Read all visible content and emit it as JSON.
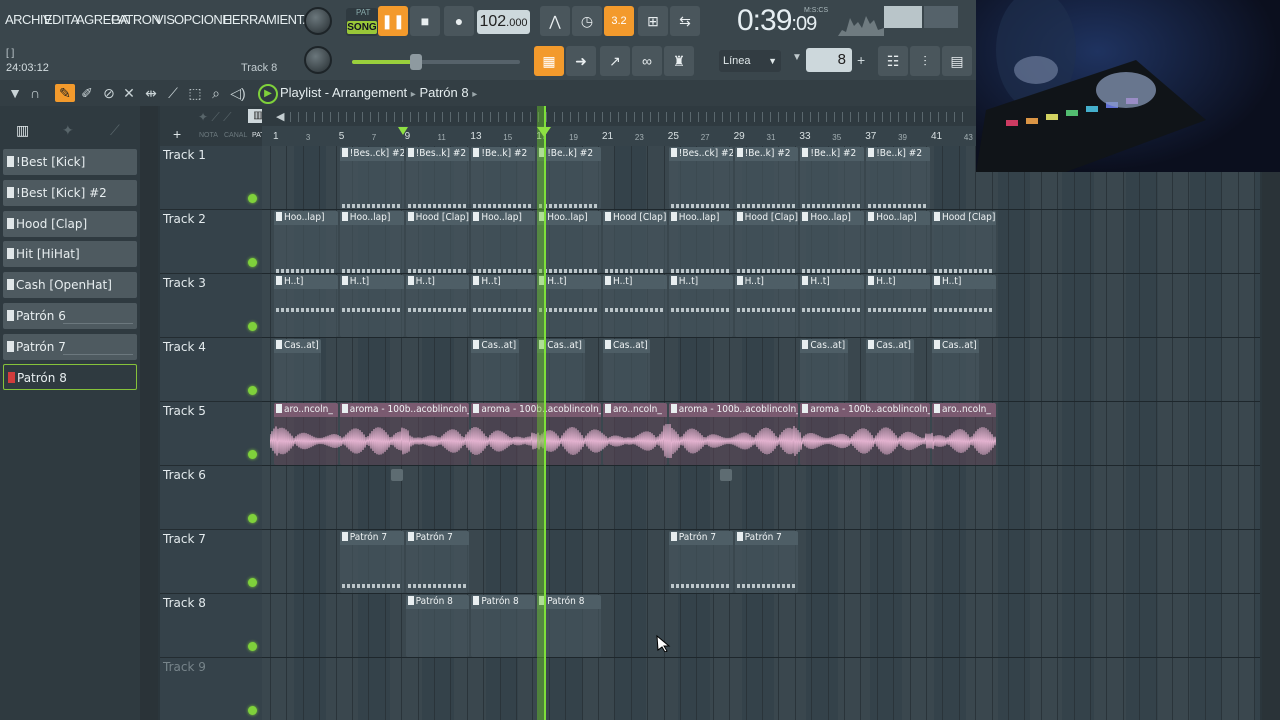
{
  "menu": {
    "items": [
      "ARCHIV",
      "EDITA",
      "AGREGA",
      "PATRON",
      "VIS",
      "OPCIONE",
      "HERRAMIENTA"
    ]
  },
  "transport": {
    "pat_label": "PAT",
    "song_label": "SONG",
    "tempo_main": "102",
    "tempo_frac": ".000",
    "time_main": "0:39",
    "time_frac": ":09",
    "time_unit": "M:S:CS",
    "pattern_step": "3.2"
  },
  "hint": {
    "brackets": "[ ]",
    "cpu_time": "24:03:12",
    "track_hint": "Track 8"
  },
  "snap": {
    "value": "Línea",
    "step_value": "8",
    "plus": "+"
  },
  "playlist": {
    "title": "Playlist - Arrangement",
    "pattern": "Patrón 8"
  },
  "left_panel": {
    "tabs": [
      "NOTA",
      "CANAL",
      "PAT"
    ],
    "add": "+"
  },
  "channels": [
    "!Best [Kick]",
    "!Best [Kick] #2",
    "Hood [Clap]",
    "Hit [HiHat]",
    "Cash [OpenHat]",
    "Patrón 6",
    "Patrón 7",
    "Patrón 8"
  ],
  "selected_channel_index": 7,
  "tracks": [
    "Track 1",
    "Track 2",
    "Track 3",
    "Track 4",
    "Track 5",
    "Track 6",
    "Track 7",
    "Track 8",
    "Track 9"
  ],
  "ruler_numbers": [
    "1",
    "3",
    "5",
    "7",
    "9",
    "11",
    "13",
    "15",
    "17",
    "19",
    "21",
    "23",
    "25",
    "27",
    "29",
    "31",
    "33",
    "35",
    "37",
    "39",
    "41",
    "43"
  ],
  "clip_labels": {
    "t1": [
      "!Bes..ck] #2",
      "!Bes..k] #2",
      "!Be..k] #2",
      "!Be..k] #2",
      "!Bes..ck] #2",
      "!Be..k] #2",
      "!Be..k] #2",
      "!Be..k] #2"
    ],
    "t2": [
      "Hoo..lap]",
      "Hoo..lap]",
      "Hood [Clap]",
      "Hoo..lap]",
      "Hoo..lap]",
      "Hood [Clap]",
      "Hoo..lap]",
      "Hood [Clap]",
      "Hoo..lap]",
      "Hoo..lap]",
      "Hood [Clap]"
    ],
    "t3": [
      "H..t]",
      "H..t]",
      "H..t]",
      "H..t]",
      "H..t]",
      "H..t]",
      "H..t]",
      "H..t]",
      "H..t]",
      "H..t]",
      "H..t]"
    ],
    "t4": [
      "Cas..at]",
      "Cas..at]",
      "Cas..at]",
      "Cas..at]",
      "Cas..at]",
      "Cas..at]",
      "Cas..at]"
    ],
    "t5": [
      "aro..ncoln_",
      "aroma - 100b..acoblincoln_",
      "aroma - 100b..acoblincoln_",
      "aro..ncoln_",
      "aroma - 100b..acoblincoln_",
      "aroma - 100b..acoblincoln_",
      "aro..ncoln_"
    ],
    "t7": [
      "Patrón 7",
      "Patrón 7",
      "Patrón 7",
      "Patrón 7"
    ],
    "t8": [
      "Patrón 8",
      "Patrón 8",
      "Patrón 8"
    ]
  },
  "colors": {
    "accent_green": "#7fd13b",
    "accent_orange": "#f39a2c",
    "audio_clip": "#7a5a70",
    "background": "#2b363c"
  },
  "icons": {
    "play": "pause-icon",
    "stop": "stop-icon",
    "record": "record-icon"
  }
}
